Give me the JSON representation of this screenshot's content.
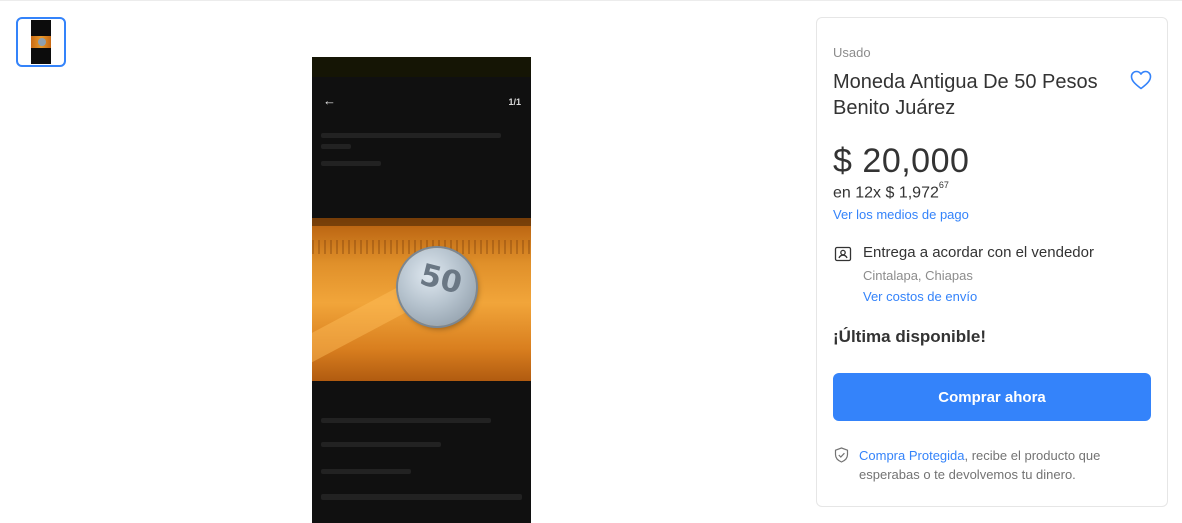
{
  "gallery": {
    "thumbnail_icon": "coin-photo-thumbnail",
    "counter": "1/1",
    "back_icon": "arrow-left-icon"
  },
  "product": {
    "condition": "Usado",
    "title": "Moneda Antigua De 50 Pesos Benito Juárez",
    "price_symbol": "$",
    "price_amount": "20,000",
    "installments_prefix": "en 12x $ 1,972",
    "installments_cents": "67",
    "payment_methods_link": "Ver los medios de pago",
    "stock": "¡Última disponible!"
  },
  "shipping": {
    "title": "Entrega a acordar con el vendedor",
    "location": "Cintalapa, Chiapas",
    "costs_link": "Ver costos de envío",
    "icon": "id-card-icon"
  },
  "actions": {
    "buy_label": "Comprar ahora",
    "favorite_icon": "heart-icon"
  },
  "protection": {
    "link": "Compra Protegida",
    "text": ", recibe el producto que esperabas o te devolvemos tu dinero.",
    "icon": "shield-check-icon"
  },
  "colors": {
    "accent": "#3483fa",
    "text": "#333333",
    "muted": "#8c8c8c",
    "border": "#e6e6e6"
  }
}
